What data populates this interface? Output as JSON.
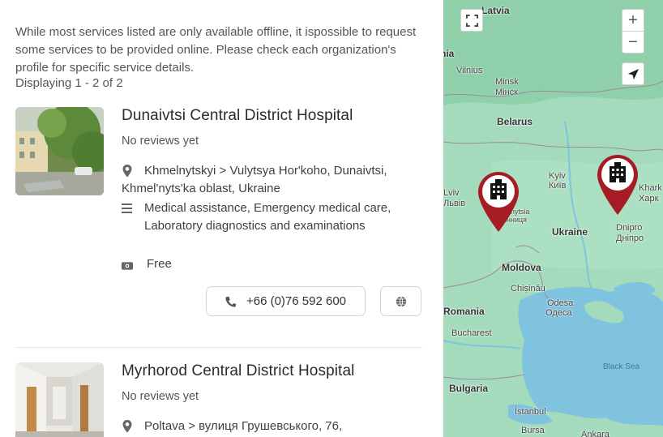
{
  "intro_text": "While most services listed are only available offline, it ispossible to request some services to be provided online. Please check each organization's profile for specific service details.",
  "count_text": "Displaying 1 - 2 of 2",
  "results": [
    {
      "title": "Dunaivtsi Central District Hospital",
      "reviews": "No reviews yet",
      "address": "Khmelnytskyi > Vulytsya Hor'koho, Dunaivtsi, Khmel'nyts'ka oblast, Ukraine",
      "services": "Medical assistance, Emergency medical care, Laboratory diagnostics and examinations",
      "price": "Free",
      "phone": "+66 (0)76 592 600"
    },
    {
      "title": "Myrhorod Central District Hospital",
      "reviews": "No reviews yet",
      "address": "Poltava > вулиця Грушевського, 76,"
    }
  ],
  "icons": {
    "location": "map-pin-icon",
    "services": "list-icon",
    "price": "money-icon",
    "phone": "phone-icon",
    "website": "globe-icon",
    "fullscreen": "fullscreen-icon",
    "locate": "navigation-arrow-icon",
    "marker": "hospital-marker-icon"
  },
  "map": {
    "zoom_in": "+",
    "zoom_out": "−",
    "labels": {
      "latvia": "Latvia",
      "lithuania": "Lithuania",
      "vilnius": "Vilnius",
      "minsk": "Minsk",
      "minsk_cyr": "Мінск",
      "belarus": "Belarus",
      "kyiv": "Kyiv",
      "kyiv_cyr": "Київ",
      "lviv": "Lviv",
      "lviv_cyr": "Львів",
      "vinnytsia": "Vinnytsia",
      "vinnytsia_cyr": "Вінниця",
      "kharkiv": "Khark",
      "kharkiv_cyr": "Харк",
      "dnipro": "Dnipro",
      "dnipro_cyr": "Дніпро",
      "ukraine": "Ukraine",
      "moldova": "Moldova",
      "chisinau": "Chișinău",
      "odesa": "Odesa",
      "odesa_cyr": "Одеса",
      "romania": "Romania",
      "bucharest": "Bucharest",
      "bulgaria": "Bulgaria",
      "black_sea": "Black Sea",
      "istanbul": "İstanbul",
      "bursa": "Bursa",
      "ankara": "Ankara"
    }
  },
  "colors": {
    "marker": "#a51c24",
    "land": "#9ed8b9",
    "sea": "#7fc3de"
  }
}
